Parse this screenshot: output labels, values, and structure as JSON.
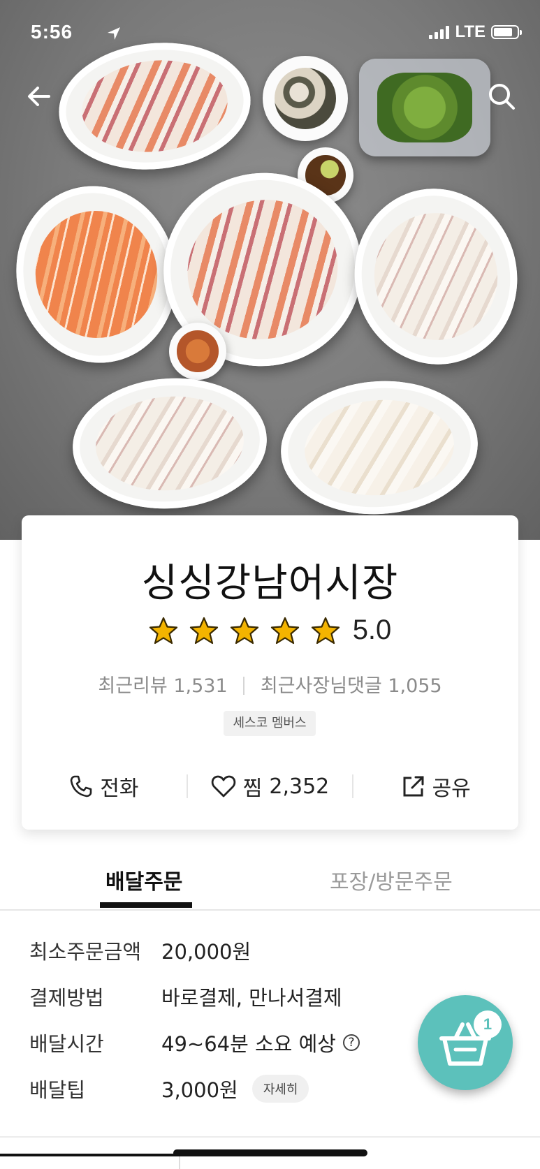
{
  "status_bar": {
    "time": "5:56",
    "network": "LTE"
  },
  "store": {
    "name": "싱싱강남어시장",
    "rating": "5.0",
    "rating_stars": 5,
    "recent_reviews_label": "최근리뷰",
    "recent_reviews_count": "1,531",
    "owner_replies_label": "최근사장님댓글",
    "owner_replies_count": "1,055",
    "badge": "세스코 멤버스"
  },
  "actions": {
    "call_label": "전화",
    "like_label": "찜",
    "like_count": "2,352",
    "share_label": "공유"
  },
  "tabs": [
    {
      "label": "배달주문",
      "active": true
    },
    {
      "label": "포장/방문주문",
      "active": false
    }
  ],
  "info": {
    "min_order": {
      "label": "최소주문금액",
      "value": "20,000원"
    },
    "payment": {
      "label": "결제방법",
      "value": "바로결제, 만나서결제"
    },
    "delivery_time": {
      "label": "배달시간",
      "value": "49~64분 소요 예상",
      "help": "?"
    },
    "delivery_tip": {
      "label": "배달팁",
      "value": "3,000원",
      "detail_button": "자세히"
    }
  },
  "cart": {
    "count": "1"
  },
  "colors": {
    "accent": "#5cc1bb",
    "star": "#f4b400"
  }
}
